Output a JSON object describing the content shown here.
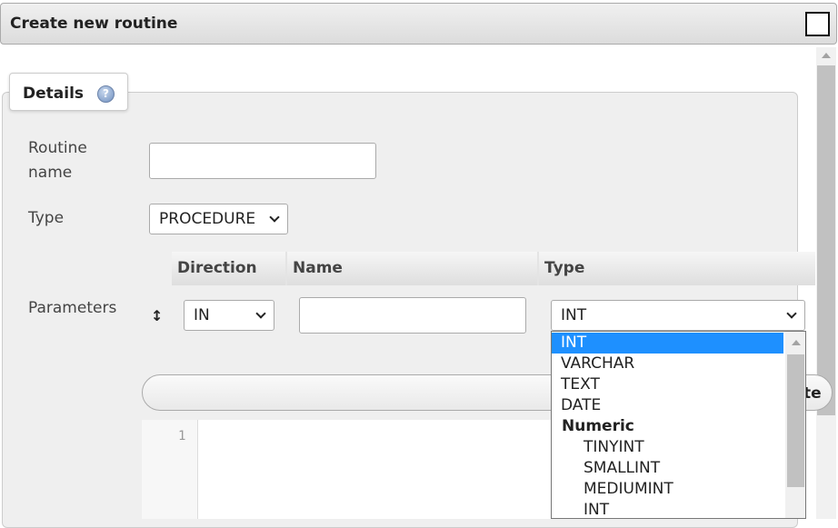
{
  "dialog": {
    "title": "Create new routine"
  },
  "tabs": [
    {
      "label": "Details"
    }
  ],
  "form": {
    "routine_name_label": "Routine name",
    "routine_name_value": "",
    "type_label": "Type",
    "type_value": "PROCEDURE",
    "parameters_label": "Parameters",
    "param_columns": [
      "Direction",
      "Name",
      "Type"
    ],
    "param_row": {
      "direction": "IN",
      "name": "",
      "type": "INT"
    },
    "hidden_bar_peek": "te"
  },
  "editor": {
    "line_numbers": [
      "1"
    ]
  },
  "type_dropdown": {
    "options": [
      {
        "label": "INT",
        "kind": "option",
        "selected": true
      },
      {
        "label": "VARCHAR",
        "kind": "option"
      },
      {
        "label": "TEXT",
        "kind": "option"
      },
      {
        "label": "DATE",
        "kind": "option"
      },
      {
        "label": "Numeric",
        "kind": "group"
      },
      {
        "label": "TINYINT",
        "kind": "child"
      },
      {
        "label": "SMALLINT",
        "kind": "child"
      },
      {
        "label": "MEDIUMINT",
        "kind": "child"
      },
      {
        "label": "INT",
        "kind": "child"
      }
    ]
  },
  "colors": {
    "selected_option_bg": "#1e90ff",
    "panel_bg": "#efefef"
  }
}
